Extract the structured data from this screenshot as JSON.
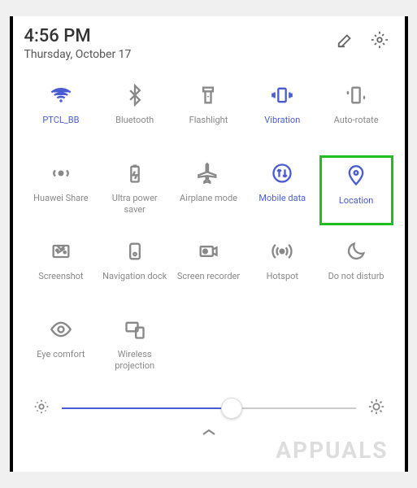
{
  "header": {
    "time": "4:56 PM",
    "date": "Thursday, October 17"
  },
  "tiles": [
    {
      "id": "wifi",
      "label": "PTCL_BB",
      "active": true
    },
    {
      "id": "bluetooth",
      "label": "Bluetooth",
      "active": false
    },
    {
      "id": "flashlight",
      "label": "Flashlight",
      "active": false
    },
    {
      "id": "vibration",
      "label": "Vibration",
      "active": true
    },
    {
      "id": "autorotate",
      "label": "Auto-rotate",
      "active": false
    },
    {
      "id": "huaweishare",
      "label": "Huawei Share",
      "active": false
    },
    {
      "id": "powersaver",
      "label": "Ultra power saver",
      "active": false
    },
    {
      "id": "airplane",
      "label": "Airplane mode",
      "active": false
    },
    {
      "id": "mobiledata",
      "label": "Mobile data",
      "active": true
    },
    {
      "id": "location",
      "label": "Location",
      "active": true,
      "highlighted": true
    },
    {
      "id": "screenshot",
      "label": "Screenshot",
      "active": false
    },
    {
      "id": "navdock",
      "label": "Navigation dock",
      "active": false
    },
    {
      "id": "screenrec",
      "label": "Screen recorder",
      "active": false
    },
    {
      "id": "hotspot",
      "label": "Hotspot",
      "active": false
    },
    {
      "id": "dnd",
      "label": "Do not disturb",
      "active": false
    },
    {
      "id": "eyecomfort",
      "label": "Eye comfort",
      "active": false
    },
    {
      "id": "wirelessproj",
      "label": "Wireless projection",
      "active": false
    }
  ],
  "brightness": {
    "percent": 58
  },
  "watermark": "APPUALS"
}
